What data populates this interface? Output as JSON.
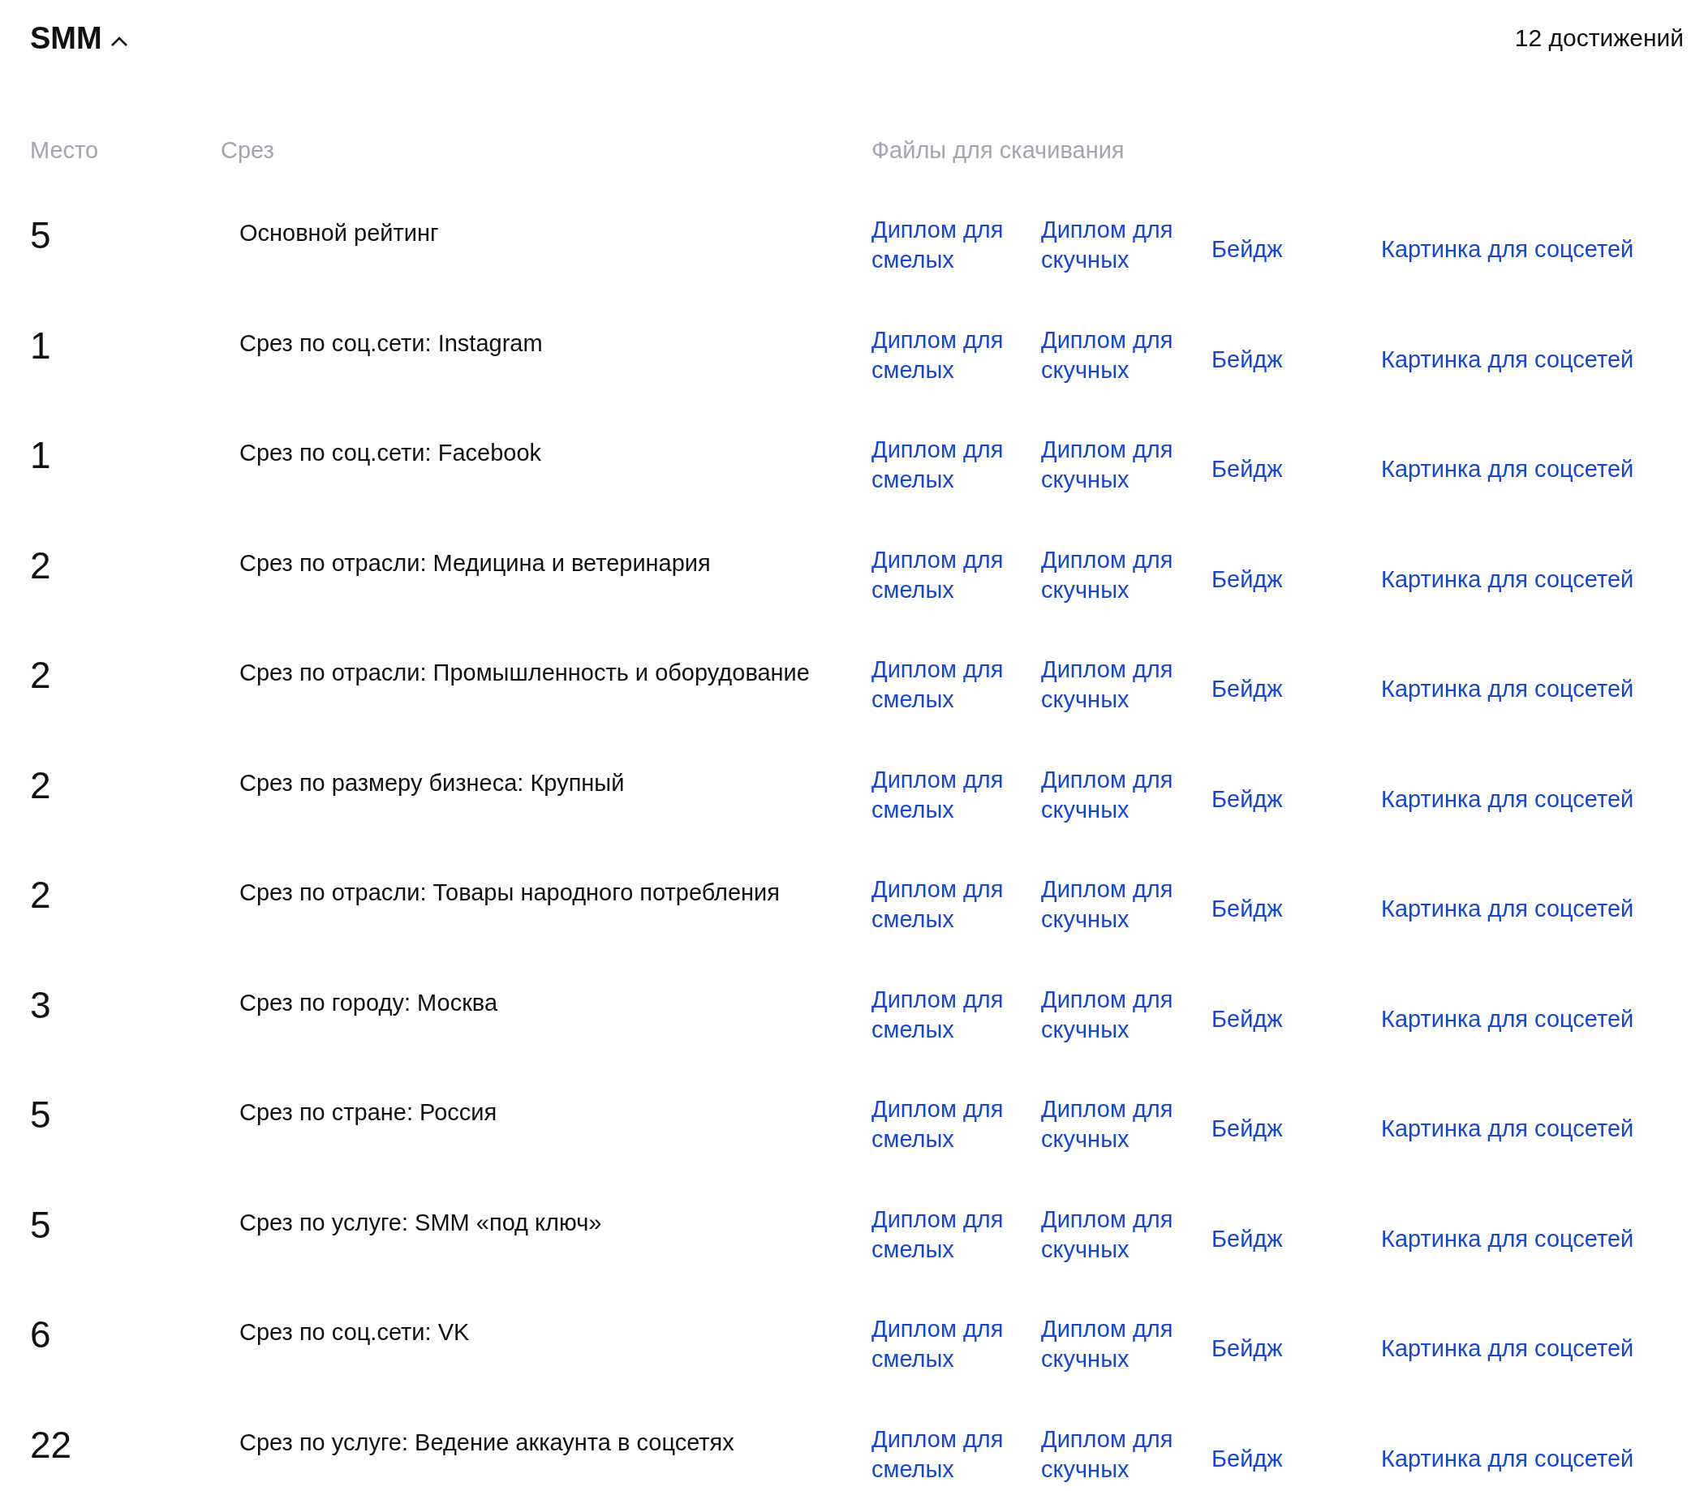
{
  "section": {
    "title": "SMM",
    "expanded": true,
    "count": "12 достижений"
  },
  "table": {
    "columns": [
      "Место",
      "Срез",
      "Файлы для скачивания"
    ],
    "rows": [
      {
        "place": "5",
        "slice": "Основной рейтинг",
        "files": [
          "Диплом для смелых",
          "Диплом для скучных",
          "Бейдж",
          "Картинка для соцсетей"
        ]
      },
      {
        "place": "1",
        "slice": "Срез по соц.сети: Instagram",
        "files": [
          "Диплом для смелых",
          "Диплом для скучных",
          "Бейдж",
          "Картинка для соцсетей"
        ]
      },
      {
        "place": "1",
        "slice": "Срез по соц.сети: Facebook",
        "files": [
          "Диплом для смелых",
          "Диплом для скучных",
          "Бейдж",
          "Картинка для соцсетей"
        ]
      },
      {
        "place": "2",
        "slice": "Срез по отрасли: Медицина и ветеринария",
        "files": [
          "Диплом для смелых",
          "Диплом для скучных",
          "Бейдж",
          "Картинка для соцсетей"
        ]
      },
      {
        "place": "2",
        "slice": "Срез по отрасли: Промышленность и оборудование",
        "files": [
          "Диплом для смелых",
          "Диплом для скучных",
          "Бейдж",
          "Картинка для соцсетей"
        ]
      },
      {
        "place": "2",
        "slice": "Срез по размеру бизнеса: Крупный",
        "files": [
          "Диплом для смелых",
          "Диплом для скучных",
          "Бейдж",
          "Картинка для соцсетей"
        ]
      },
      {
        "place": "2",
        "slice": "Срез по отрасли: Товары народного потребления",
        "files": [
          "Диплом для смелых",
          "Диплом для скучных",
          "Бейдж",
          "Картинка для соцсетей"
        ]
      },
      {
        "place": "3",
        "slice": "Срез по городу: Москва",
        "files": [
          "Диплом для смелых",
          "Диплом для скучных",
          "Бейдж",
          "Картинка для соцсетей"
        ]
      },
      {
        "place": "5",
        "slice": "Срез по стране: Россия",
        "files": [
          "Диплом для смелых",
          "Диплом для скучных",
          "Бейдж",
          "Картинка для соцсетей"
        ]
      },
      {
        "place": "5",
        "slice": "Срез по услуге: SMM «под ключ»",
        "files": [
          "Диплом для смелых",
          "Диплом для скучных",
          "Бейдж",
          "Картинка для соцсетей"
        ]
      },
      {
        "place": "6",
        "slice": "Срез по соц.сети: VK",
        "files": [
          "Диплом для смелых",
          "Диплом для скучных",
          "Бейдж",
          "Картинка для соцсетей"
        ]
      },
      {
        "place": "22",
        "slice": "Срез по услуге: Ведение аккаунта в соцсетях",
        "files": [
          "Диплом для смелых",
          "Диплом для скучных",
          "Бейдж",
          "Картинка для соцсетей"
        ]
      }
    ]
  }
}
